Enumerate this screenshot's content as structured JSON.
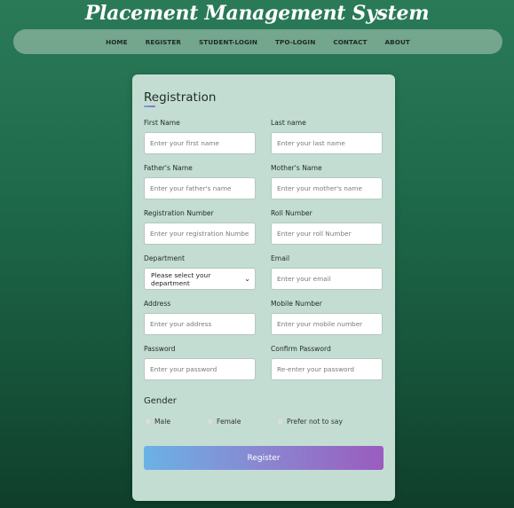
{
  "site": {
    "title": "Placement Management System"
  },
  "nav": {
    "items": [
      {
        "label": "HOME"
      },
      {
        "label": "REGISTER"
      },
      {
        "label": "STUDENT-LOGIN"
      },
      {
        "label": "TPO-LOGIN"
      },
      {
        "label": "CONTACT"
      },
      {
        "label": "ABOUT"
      }
    ]
  },
  "form": {
    "title": "Registration",
    "fields": {
      "first_name": {
        "label": "First Name",
        "placeholder": "Enter your first name",
        "value": ""
      },
      "last_name": {
        "label": "Last name",
        "placeholder": "Enter your last name",
        "value": ""
      },
      "father_name": {
        "label": "Father's Name",
        "placeholder": "Enter your father's name",
        "value": ""
      },
      "mother_name": {
        "label": "Mother's Name",
        "placeholder": "Enter your mother's name",
        "value": ""
      },
      "registration_number": {
        "label": "Registration Number",
        "placeholder": "Enter your registration Number",
        "value": ""
      },
      "roll_number": {
        "label": "Roll Number",
        "placeholder": "Enter your roll Number",
        "value": ""
      },
      "department": {
        "label": "Department",
        "selected": "Please select your department"
      },
      "email": {
        "label": "Email",
        "placeholder": "Enter your email",
        "value": ""
      },
      "address": {
        "label": "Address",
        "placeholder": "Enter your address",
        "value": ""
      },
      "mobile": {
        "label": "Mobile Number",
        "placeholder": "Enter your mobile number",
        "value": ""
      },
      "password": {
        "label": "Password",
        "placeholder": "Enter your password",
        "value": ""
      },
      "confirm_password": {
        "label": "Confirm Password",
        "placeholder": "Re-enter your password",
        "value": ""
      }
    },
    "gender": {
      "title": "Gender",
      "options": [
        {
          "label": "Male"
        },
        {
          "label": "Female"
        },
        {
          "label": "Prefer not to say"
        }
      ]
    },
    "submit_label": "Register"
  },
  "colors": {
    "background_top": "#2a7a58",
    "background_bottom": "#0f3f2b",
    "card": "#c3ddd3",
    "button_gradient_start": "#6ab2e6",
    "button_gradient_end": "#9a5cbf"
  },
  "icons": {
    "department_select": "chevron-down-icon"
  }
}
